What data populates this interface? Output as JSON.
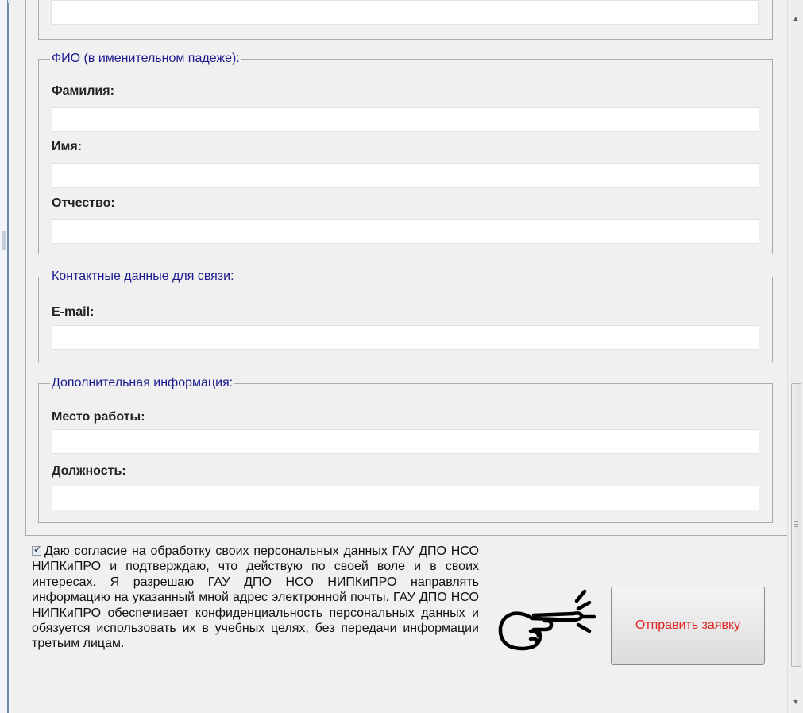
{
  "sections": {
    "fio": {
      "legend": "ФИО (в именительном падеже):",
      "fields": [
        {
          "label": "Фамилия:",
          "value": ""
        },
        {
          "label": "Имя:",
          "value": ""
        },
        {
          "label": "Отчество:",
          "value": ""
        }
      ]
    },
    "contact": {
      "legend": "Контактные данные для связи:",
      "fields": [
        {
          "label": "E-mail:",
          "value": ""
        }
      ]
    },
    "extra": {
      "legend": "Дополнительная информация:",
      "fields": [
        {
          "label": "Место работы:",
          "value": ""
        },
        {
          "label": "Должность:",
          "value": ""
        }
      ]
    }
  },
  "consent": {
    "checked": true,
    "text": "Даю согласие на обработку своих персональных данных ГАУ ДПО НСО НИПКиПРО и подтверждаю, что действую по своей воле и в своих интересах. Я разрешаю ГАУ ДПО НСО НИПКиПРО направлять информацию на указанный мной адрес электронной почты. ГАУ ДПО НСО НИПКиПРО обеспечивает конфиденциальность персональных данных и обязуется использовать их в учебных целях, без передачи информации третьим лицам."
  },
  "submit": {
    "label": "Отправить заявку",
    "color": "#e02424"
  },
  "icons": {
    "pointer": "pointing-hand-icon",
    "scroll_up": "arrow-up-icon",
    "scroll_down": "arrow-down-icon"
  },
  "scroll": {
    "up_glyph": "▲",
    "down_glyph": "▼"
  }
}
